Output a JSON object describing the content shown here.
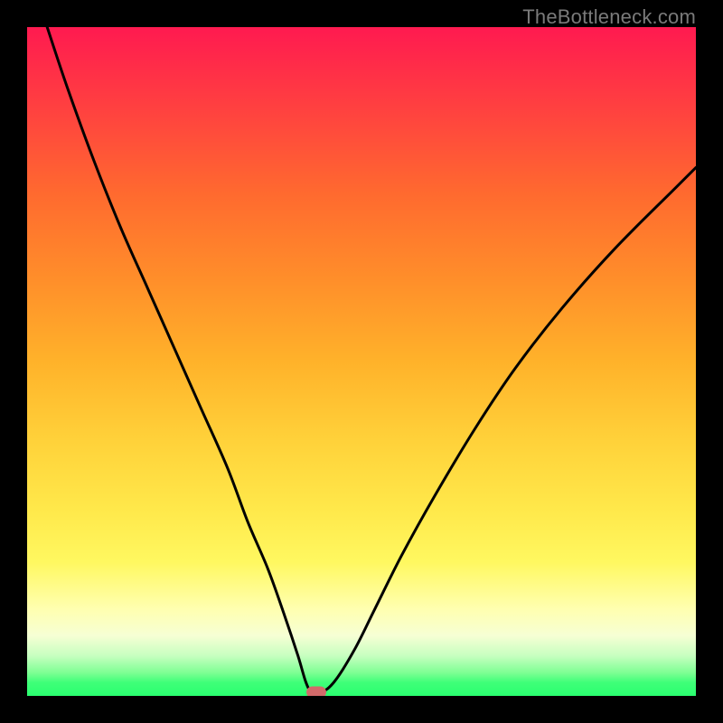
{
  "watermark": "TheBottleneck.com",
  "chart_data": {
    "type": "line",
    "title": "",
    "xlabel": "",
    "ylabel": "",
    "xlim": [
      0,
      100
    ],
    "ylim": [
      0,
      100
    ],
    "series": [
      {
        "name": "bottleneck-curve",
        "x": [
          3,
          6,
          10,
          14,
          18,
          22,
          26,
          30,
          33,
          36,
          38.5,
          40.5,
          41.7,
          42.6,
          44,
          46,
          49,
          52,
          56,
          61,
          67,
          73,
          80,
          88,
          97,
          100
        ],
        "y": [
          100,
          91,
          80,
          70,
          61,
          52,
          43,
          34,
          26,
          19,
          12,
          6,
          2,
          0.5,
          0.5,
          2.2,
          7,
          13,
          21,
          30,
          40,
          49,
          58,
          67,
          76,
          79
        ]
      }
    ],
    "marker": {
      "x": 43.2,
      "y": 0.6
    },
    "gradient_stops": [
      {
        "pos": 0,
        "color": "#ff1a50"
      },
      {
        "pos": 0.12,
        "color": "#ff4040"
      },
      {
        "pos": 0.25,
        "color": "#ff6a2f"
      },
      {
        "pos": 0.38,
        "color": "#ff8f2a"
      },
      {
        "pos": 0.5,
        "color": "#ffb22a"
      },
      {
        "pos": 0.62,
        "color": "#ffd23a"
      },
      {
        "pos": 0.72,
        "color": "#ffe84a"
      },
      {
        "pos": 0.8,
        "color": "#fff860"
      },
      {
        "pos": 0.87,
        "color": "#ffffb0"
      },
      {
        "pos": 0.91,
        "color": "#f6ffd4"
      },
      {
        "pos": 0.94,
        "color": "#c7ffc0"
      },
      {
        "pos": 0.965,
        "color": "#7fff94"
      },
      {
        "pos": 0.98,
        "color": "#3fff78"
      },
      {
        "pos": 1.0,
        "color": "#2aff70"
      }
    ]
  }
}
